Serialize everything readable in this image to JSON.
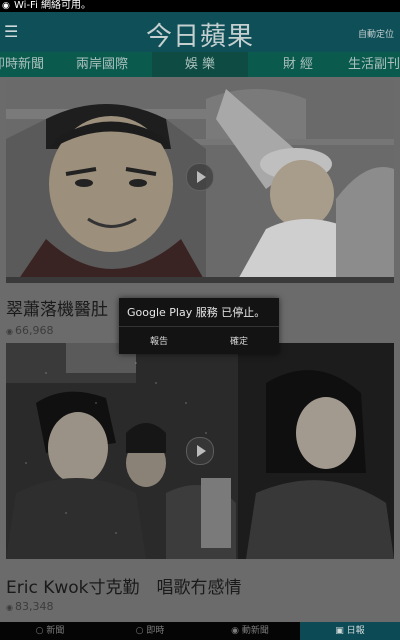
{
  "status_bar": {
    "text": "Wi-Fi 網絡可用。"
  },
  "app_bar": {
    "title": "今日蘋果",
    "right_label": "自動定位"
  },
  "tabs": [
    {
      "label": "即時新聞"
    },
    {
      "label": "兩岸國際"
    },
    {
      "label": "娛 樂"
    },
    {
      "label": "財 經"
    },
    {
      "label": "生活副刊"
    }
  ],
  "articles": [
    {
      "headline": "",
      "views": ""
    },
    {
      "headline": "翠蕭落機醫肚",
      "views": "66,968"
    },
    {
      "headline": "Eric Kwok寸克勤　唱歌冇感情",
      "views": "83,348"
    }
  ],
  "dialog": {
    "message": "Google Play 服務 已停止。",
    "report_label": "報告",
    "ok_label": "確定"
  },
  "bottom_nav": [
    {
      "label": "新聞"
    },
    {
      "label": "即時"
    },
    {
      "label": "動新聞"
    },
    {
      "label": "日報"
    }
  ],
  "colors": {
    "app_bar": "#0f4f57",
    "tabs": "#0b5a4e",
    "active_tab": "#0e4c43",
    "bottom_active": "#0c4b55"
  }
}
